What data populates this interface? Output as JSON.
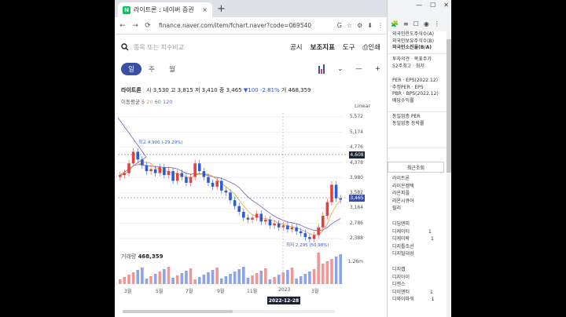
{
  "browser": {
    "tab_title": "라이트론 : 네이버 증권",
    "tab_close": "×",
    "new_tab": "+",
    "url": "finance.naver.com/item/fchart.naver?code=069540",
    "nav": {
      "back": "←",
      "forward": "→",
      "reload": "⟳"
    },
    "omni_icons": [
      "G",
      "☆",
      "⚙",
      "⬇",
      "⋮"
    ]
  },
  "search": {
    "placeholder": "종목 또는 지수비교",
    "icon": "search-icon"
  },
  "toplinks": {
    "disclosure": "공시",
    "indicators": "보조지표",
    "tools": "도구",
    "print": "인쇄"
  },
  "periods": [
    "일",
    "주",
    "월"
  ],
  "active_period": "일",
  "period_icons": {
    "chart_type": "candlestick-icon",
    "caret": "⌄",
    "minus": "—",
    "plus": "+"
  },
  "quote": {
    "name": "라이트론",
    "open_label": "시",
    "open": "3,530",
    "high_label": "고",
    "high": "3,815",
    "low_label": "저",
    "low": "3,410",
    "close_label": "종",
    "close": "3,465",
    "change": "▼100",
    "change_pct": "-2.81%",
    "volume_label": "거",
    "volume": "468,359"
  },
  "moving_avg": {
    "label": "이동평균",
    "m5": "5",
    "m20": "20",
    "m60": "60",
    "m120": "120"
  },
  "scale": "Linear",
  "chart_data": {
    "type": "candlestick",
    "y_ticks": [
      "5,572",
      "5,174",
      "4,776",
      "4,378",
      "3,980",
      "3,582",
      "3,184",
      "2,786",
      "2,388"
    ],
    "current_price_tag": "4,608",
    "last_price_tag": "3,465",
    "high_annotation": "최고 4,900 (-29.29%)",
    "low_annotation": "최저 2,295 (50.98%)",
    "x_labels": [
      "3월",
      "5월",
      "7월",
      "9월",
      "11월",
      "2023",
      "3월"
    ],
    "crosshair_date": "2022-12-28",
    "volume_label": "거래량",
    "volume": "468,359",
    "volume_tick": "1.26m",
    "ylim": [
      2300,
      5700
    ],
    "close_series": [
      4100,
      4150,
      4400,
      4700,
      4500,
      4350,
      4200,
      4250,
      4150,
      4300,
      4100,
      4200,
      3950,
      4150,
      4050,
      3900,
      4050,
      4400,
      4200,
      4050,
      3900,
      3800,
      3950,
      3700,
      3650,
      3450,
      3300,
      3150,
      3000,
      2950,
      3000,
      3100,
      2900,
      2950,
      2800,
      2850,
      2750,
      2800,
      2700,
      2750,
      2650,
      2600,
      2500,
      2450,
      2550,
      2750,
      3050,
      3400,
      3850,
      3500,
      3465
    ]
  },
  "right_panel": {
    "window_controls": [
      "—",
      "☐",
      "✕"
    ],
    "ext_icons": [
      "🧩",
      "≡",
      "☐",
      "◉",
      "⋮"
    ],
    "info_items": [
      {
        "text": "외국인한도주식수(A)",
        "sub": false
      },
      {
        "text": "외국인보유주식수(B)",
        "sub": false
      },
      {
        "text": "외국인소진율(B/A)",
        "sub": false
      },
      {
        "text": "투자의견 · 목표주가",
        "sub": false
      },
      {
        "text": "52주최고 · 최저",
        "sub": false
      },
      {
        "text": "PER · EPS(2022.12)",
        "sub": false
      },
      {
        "text": "추정PER · EPS",
        "sub": false
      },
      {
        "text": "PBR · BPS(2022.12)",
        "sub": false
      },
      {
        "text": "배당수익률",
        "sub": false
      },
      {
        "text": "동일업종 PER",
        "sub": false
      },
      {
        "text": "동일업종 등락률",
        "sub": false
      }
    ],
    "recent_title": "최근조회",
    "recent_items": [
      "라이트론",
      "라이온켐텍",
      "라온피플",
      "라온시큐어",
      "릴리",
      "디딤앤피",
      "디케이티",
      "디케이락",
      "디지틀조선",
      "디지털대성",
      "디지캡",
      "디지아이",
      "디젠스",
      "디이엔티",
      "디와이파워"
    ],
    "recent_counts": [
      "",
      "",
      "",
      "",
      "",
      "",
      "1",
      "1",
      "",
      "",
      "",
      "",
      "",
      "1",
      "1"
    ]
  }
}
